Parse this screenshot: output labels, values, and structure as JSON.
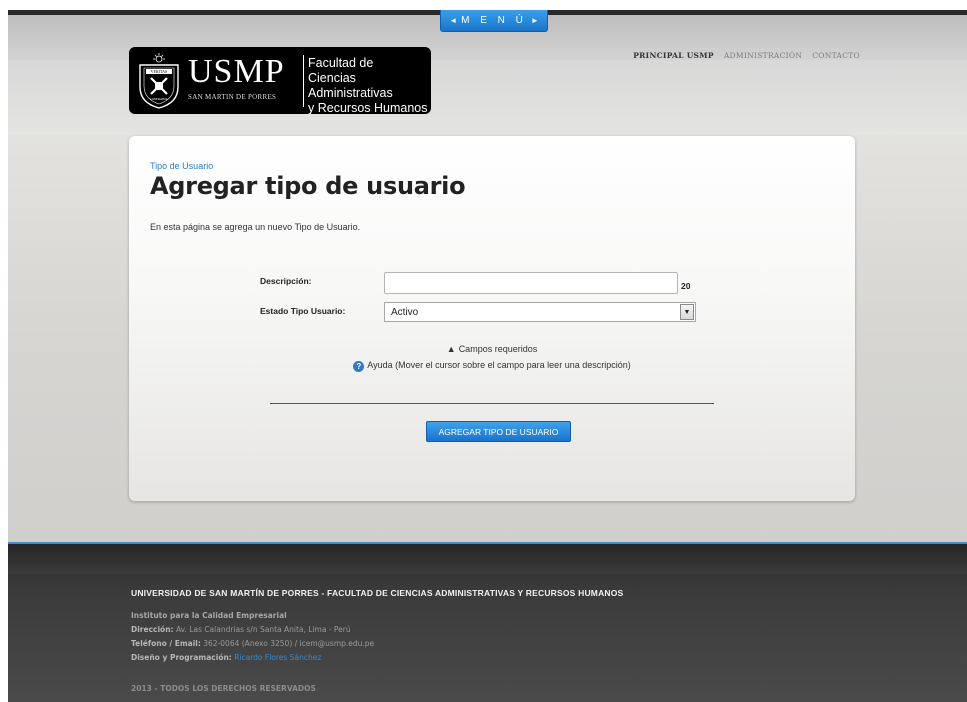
{
  "menu": {
    "label": "M E N Ú",
    "left_arrow": "◄",
    "right_arrow": "►"
  },
  "logo": {
    "wordmark": "USMP",
    "sub_wordmark": "SAN MARTIN DE PORRES",
    "faculty_line1": "Facultad de",
    "faculty_line2": "Ciencias Administrativas",
    "faculty_line3": "y Recursos Humanos",
    "crest_text": "VERITAS LIBERABIT VOS"
  },
  "topnav": {
    "items": [
      {
        "label": "PRINCIPAL USMP",
        "active": true
      },
      {
        "label": "ADMINISTRACIÓN",
        "active": false
      },
      {
        "label": "CONTACTO",
        "active": false
      }
    ]
  },
  "page": {
    "breadcrumb": "Tipo de Usuario",
    "title": "Agregar tipo de usuario",
    "intro": "En esta página se agrega un nuevo Tipo de Usuario."
  },
  "form": {
    "descripcion_label": "Descripción:",
    "descripcion_value": "",
    "descripcion_max_chars": "20",
    "estado_label": "Estado Tipo Usuario:",
    "estado_selected": "Activo",
    "required_note": "Campos requeridos",
    "help_note": "Ayuda (Mover el cursor sobre el campo para leer una descripción)",
    "submit_label": "AGREGAR TIPO DE USUARIO"
  },
  "footer": {
    "title": "UNIVERSIDAD DE SAN MARTÍN DE PORRES - FACULTAD DE CIENCIAS ADMINISTRATIVAS Y RECURSOS HUMANOS",
    "org": "Instituto para la Calidad Empresarial",
    "address_label": "Dirección:",
    "address_value": "Av. Las Calandrias s/n Santa Anita, Lima - Perú",
    "phone_label": "Teléfono / Email:",
    "phone_value": "362-0064 (Anexo 3250) / icem@usmp.edu.pe",
    "design_label": "Diseño y Programación:",
    "design_value": "Ricardo Flores Sánchez",
    "copyright": "2013 - TODOS LOS DERECHOS RESERVADOS"
  },
  "colors": {
    "accent_blue": "#1a74cc",
    "link_blue": "#2a7ec8",
    "footer_bg": "#3a3a3a"
  }
}
